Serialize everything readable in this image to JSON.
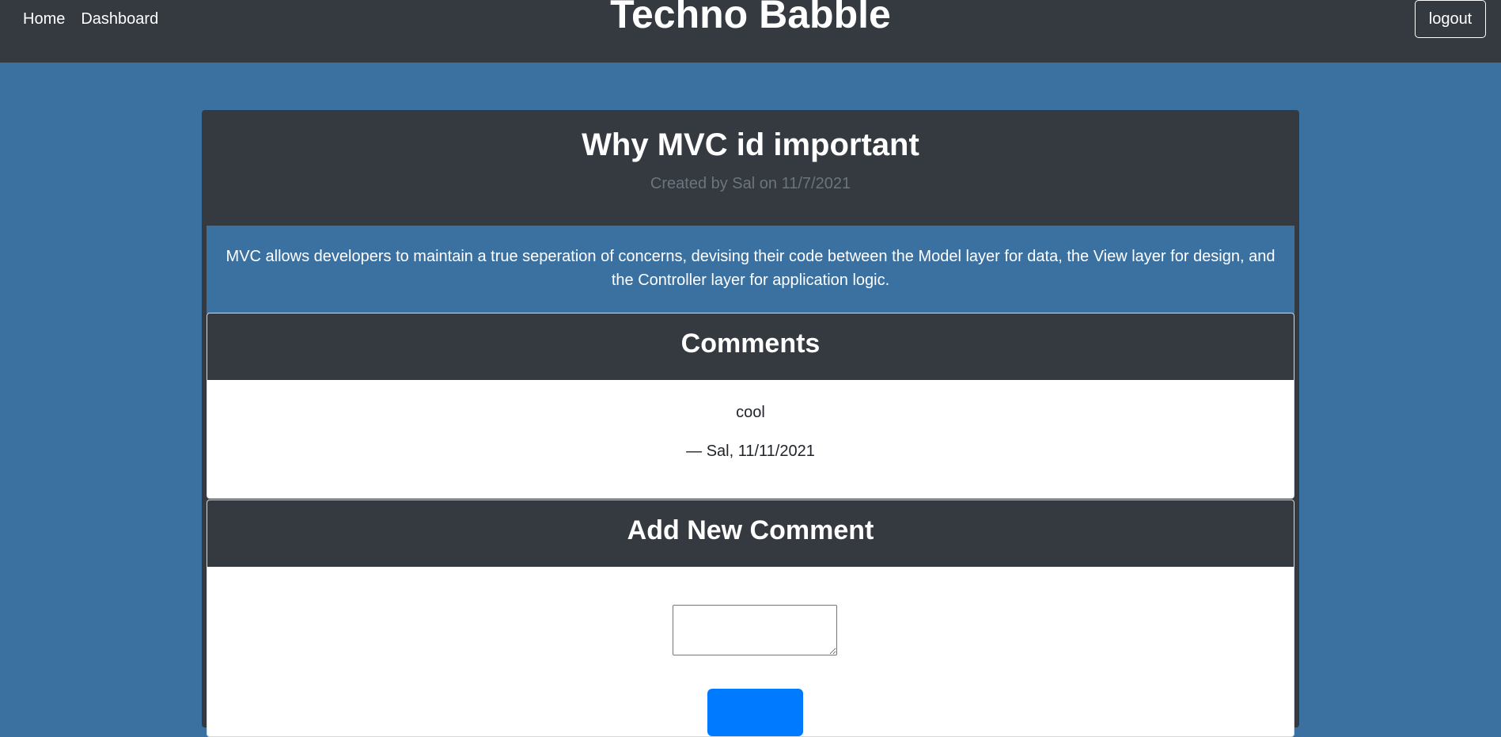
{
  "nav": {
    "links": [
      {
        "label": "Home"
      },
      {
        "label": "Dashboard"
      }
    ],
    "site_title": "Techno Babble",
    "logout_label": "logout"
  },
  "post": {
    "title": "Why MVC id important",
    "meta": "Created by Sal on 11/7/2021",
    "body": "MVC allows developers to maintain a true seperation of concerns, devising their code between the Model layer for data, the View layer for design, and the Controller layer for application logic."
  },
  "comments": {
    "heading": "Comments",
    "items": [
      {
        "text": "cool",
        "footer": "— Sal, 11/11/2021"
      }
    ]
  },
  "add_comment": {
    "heading": "Add New Comment",
    "input_value": "",
    "submit_label": ""
  },
  "colors": {
    "page_background": "#3a71a0",
    "navbar": "#343a40",
    "primary_button": "#007bff",
    "meta_text": "#6c757d"
  }
}
